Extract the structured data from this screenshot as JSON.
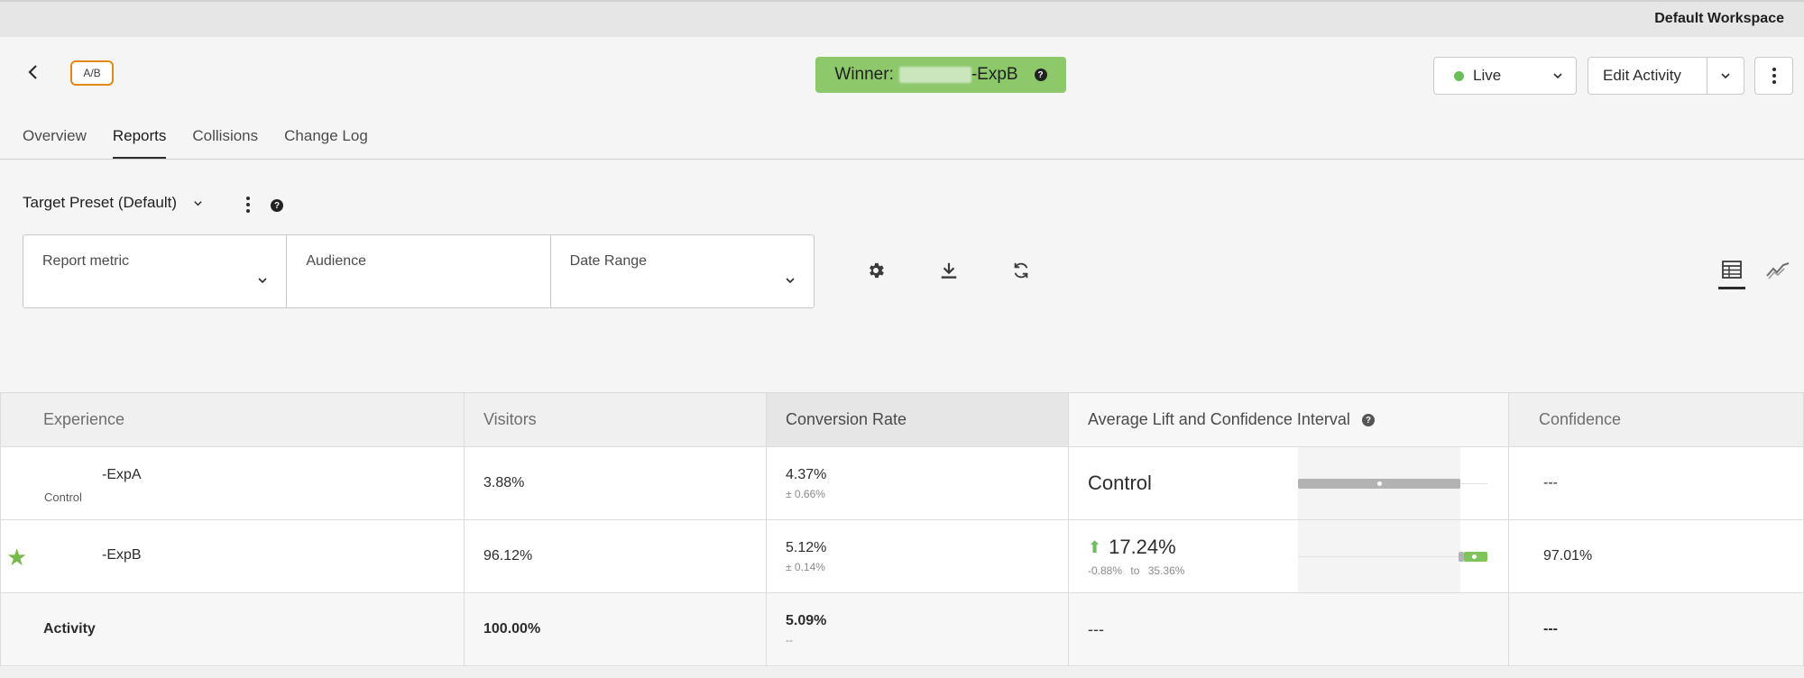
{
  "header": {
    "workspace": "Default Workspace",
    "activity_type_badge": "A/B",
    "winner": {
      "prefix": "Winner:",
      "name_suffix": "-ExpB",
      "help": "?"
    },
    "status_button": {
      "label": "Live",
      "status_color": "#6bbf59"
    },
    "edit_button": {
      "label": "Edit Activity"
    }
  },
  "tabs": [
    {
      "label": "Overview",
      "active": false
    },
    {
      "label": "Reports",
      "active": true
    },
    {
      "label": "Collisions",
      "active": false
    },
    {
      "label": "Change Log",
      "active": false
    }
  ],
  "preset": {
    "label": "Target Preset (Default)",
    "help": "?"
  },
  "filters": {
    "report_metric": {
      "label": "Report metric",
      "value": ""
    },
    "audience": {
      "label": "Audience",
      "value": ""
    },
    "date_range": {
      "label": "Date Range",
      "value": ""
    }
  },
  "toolbar_icons": [
    "gear-icon",
    "download-icon",
    "refresh-icon"
  ],
  "view_icons": [
    "table-view-icon",
    "trend-chart-icon"
  ],
  "table": {
    "columns": {
      "experience": "Experience",
      "visitors": "Visitors",
      "conversion_rate": "Conversion Rate",
      "avg_lift": "Average Lift and Confidence Interval",
      "avg_lift_help": "?",
      "confidence": "Confidence"
    },
    "rows": [
      {
        "experience": "-ExpA",
        "experience_tag": "Control",
        "visitors": "3.88%",
        "conversion": "4.37%",
        "conversion_ci": "± 0.66%",
        "lift": "Control",
        "confidence": "---"
      },
      {
        "experience": "-ExpB",
        "winner": true,
        "visitors": "96.12%",
        "conversion": "5.12%",
        "conversion_ci": "± 0.14%",
        "lift": "17.24%",
        "lift_low": "-0.88%",
        "lift_to": "to",
        "lift_high": "35.36%",
        "confidence": "97.01%"
      }
    ],
    "activity_row": {
      "label": "Activity",
      "visitors": "100.00%",
      "conversion": "5.09%",
      "conversion_ci": "--",
      "lift": "---",
      "confidence": "---"
    }
  },
  "colors": {
    "winner_banner": "#8dc86b",
    "badge_border": "#e68619",
    "positive": "#6bbf59",
    "control_bar": "#b3b3b3",
    "winner_bar": "#7fc35b"
  }
}
